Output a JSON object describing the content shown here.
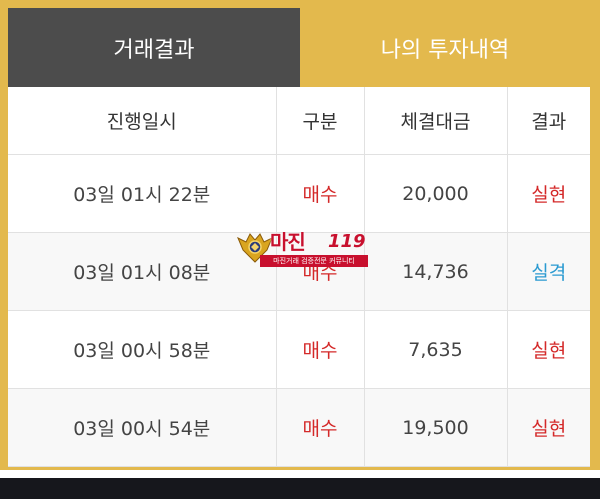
{
  "tabs": {
    "trade_result": "거래결과",
    "my_investment": "나의 투자내역"
  },
  "table": {
    "headers": [
      "진행일시",
      "구분",
      "체결대금",
      "결과"
    ],
    "rows": [
      {
        "datetime": "03일 01시 22분",
        "type": "매수",
        "amount": "20,000",
        "result": "실현"
      },
      {
        "datetime": "03일 01시 08분",
        "type": "매수",
        "amount": "14,736",
        "result": "실격"
      },
      {
        "datetime": "03일 00시 58분",
        "type": "매수",
        "amount": "7,635",
        "result": "실현"
      },
      {
        "datetime": "03일 00시 54분",
        "type": "매수",
        "amount": "19,500",
        "result": "실현"
      }
    ]
  },
  "watermark": {
    "title": "마진",
    "number": "119",
    "subtitle": "마진거래 검증전문 커뮤니티"
  },
  "colors": {
    "gold": "#e3b94d",
    "dark_tab": "#4c4c4c",
    "buy_red": "#d42929",
    "fail_blue": "#2a9ad1"
  }
}
